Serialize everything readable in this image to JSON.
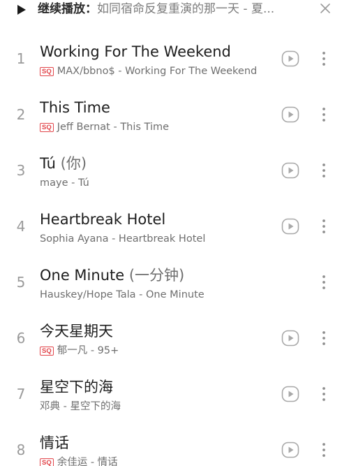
{
  "resume": {
    "label": "继续播放",
    "separator": "：",
    "title": "如同宿命反复重演的那一天 - 夏...",
    "play_icon": "play-icon",
    "close_icon": "close-icon"
  },
  "songs": [
    {
      "index": "1",
      "title": "Working For The Weekend",
      "title_ext": "",
      "sq": "SQ",
      "subtitle": "MAX/bbno$ - Working For The Weekend",
      "has_play": true
    },
    {
      "index": "2",
      "title": "This Time",
      "title_ext": "",
      "sq": "SQ",
      "subtitle": "Jeff Bernat - This Time",
      "has_play": true
    },
    {
      "index": "3",
      "title": "Tú",
      "title_ext": " (你)",
      "sq": "",
      "subtitle": "maye - Tú",
      "has_play": true
    },
    {
      "index": "4",
      "title": "Heartbreak Hotel",
      "title_ext": "",
      "sq": "",
      "subtitle": "Sophia Ayana - Heartbreak Hotel",
      "has_play": true
    },
    {
      "index": "5",
      "title": "One Minute",
      "title_ext": " (一分钟)",
      "sq": "",
      "subtitle": "Hauskey/Hope Tala - One Minute",
      "has_play": false
    },
    {
      "index": "6",
      "title": "今天星期天",
      "title_ext": "",
      "sq": "SQ",
      "subtitle": "郁一凡 - 95+",
      "has_play": true
    },
    {
      "index": "7",
      "title": "星空下的海",
      "title_ext": "",
      "sq": "",
      "subtitle": "邓典 - 星空下的海",
      "has_play": true
    },
    {
      "index": "8",
      "title": "情话",
      "title_ext": "",
      "sq": "SQ",
      "subtitle": "余佳运 - 情话",
      "has_play": true
    }
  ],
  "colors": {
    "accent": "#e2454a",
    "text_primary": "#1d1d1d",
    "text_secondary": "#6e6e6e"
  }
}
